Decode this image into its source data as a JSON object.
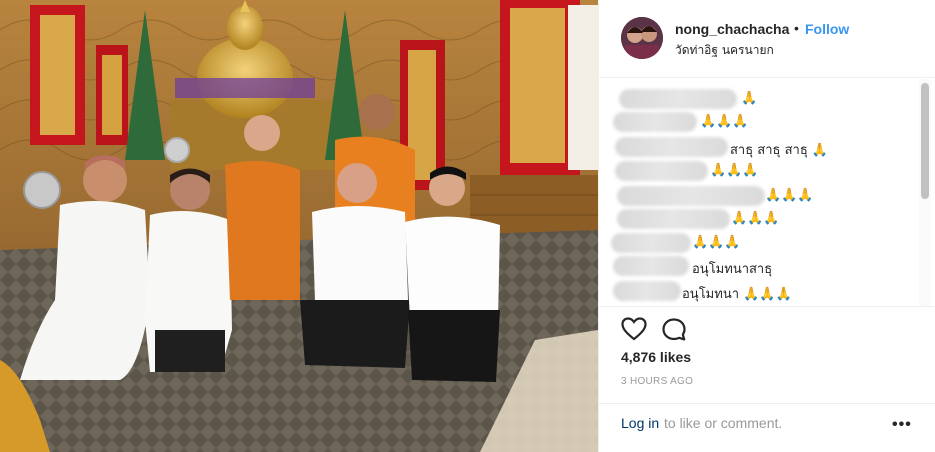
{
  "post": {
    "username": "nong_chachacha",
    "separator": "•",
    "follow_label": "Follow",
    "location": "วัดท่าอิฐ นครนายก",
    "likes": "4,876 likes",
    "time": "3 HOURS AGO",
    "login_link": "Log in",
    "login_rest": "to like or comment.",
    "more": "•••"
  },
  "comments": [
    {
      "text": "🙏"
    },
    {
      "text": "🙏🙏🙏"
    },
    {
      "text": "สาธุ สาธุ สาธุ 🙏"
    },
    {
      "text": "🙏🙏🙏"
    },
    {
      "text": "🙏🙏🙏"
    },
    {
      "text": "🙏🙏🙏"
    },
    {
      "text": "🙏🙏🙏"
    },
    {
      "text": "อนุโมทนาสาธุ"
    },
    {
      "text": "อนุโมทนา 🙏🙏🙏"
    }
  ],
  "colors": {
    "link_blue": "#3897f0",
    "text": "#262626",
    "muted": "#999999",
    "border": "#efefef"
  },
  "icons": [
    "heart-icon",
    "comment-icon",
    "more-options-icon"
  ]
}
